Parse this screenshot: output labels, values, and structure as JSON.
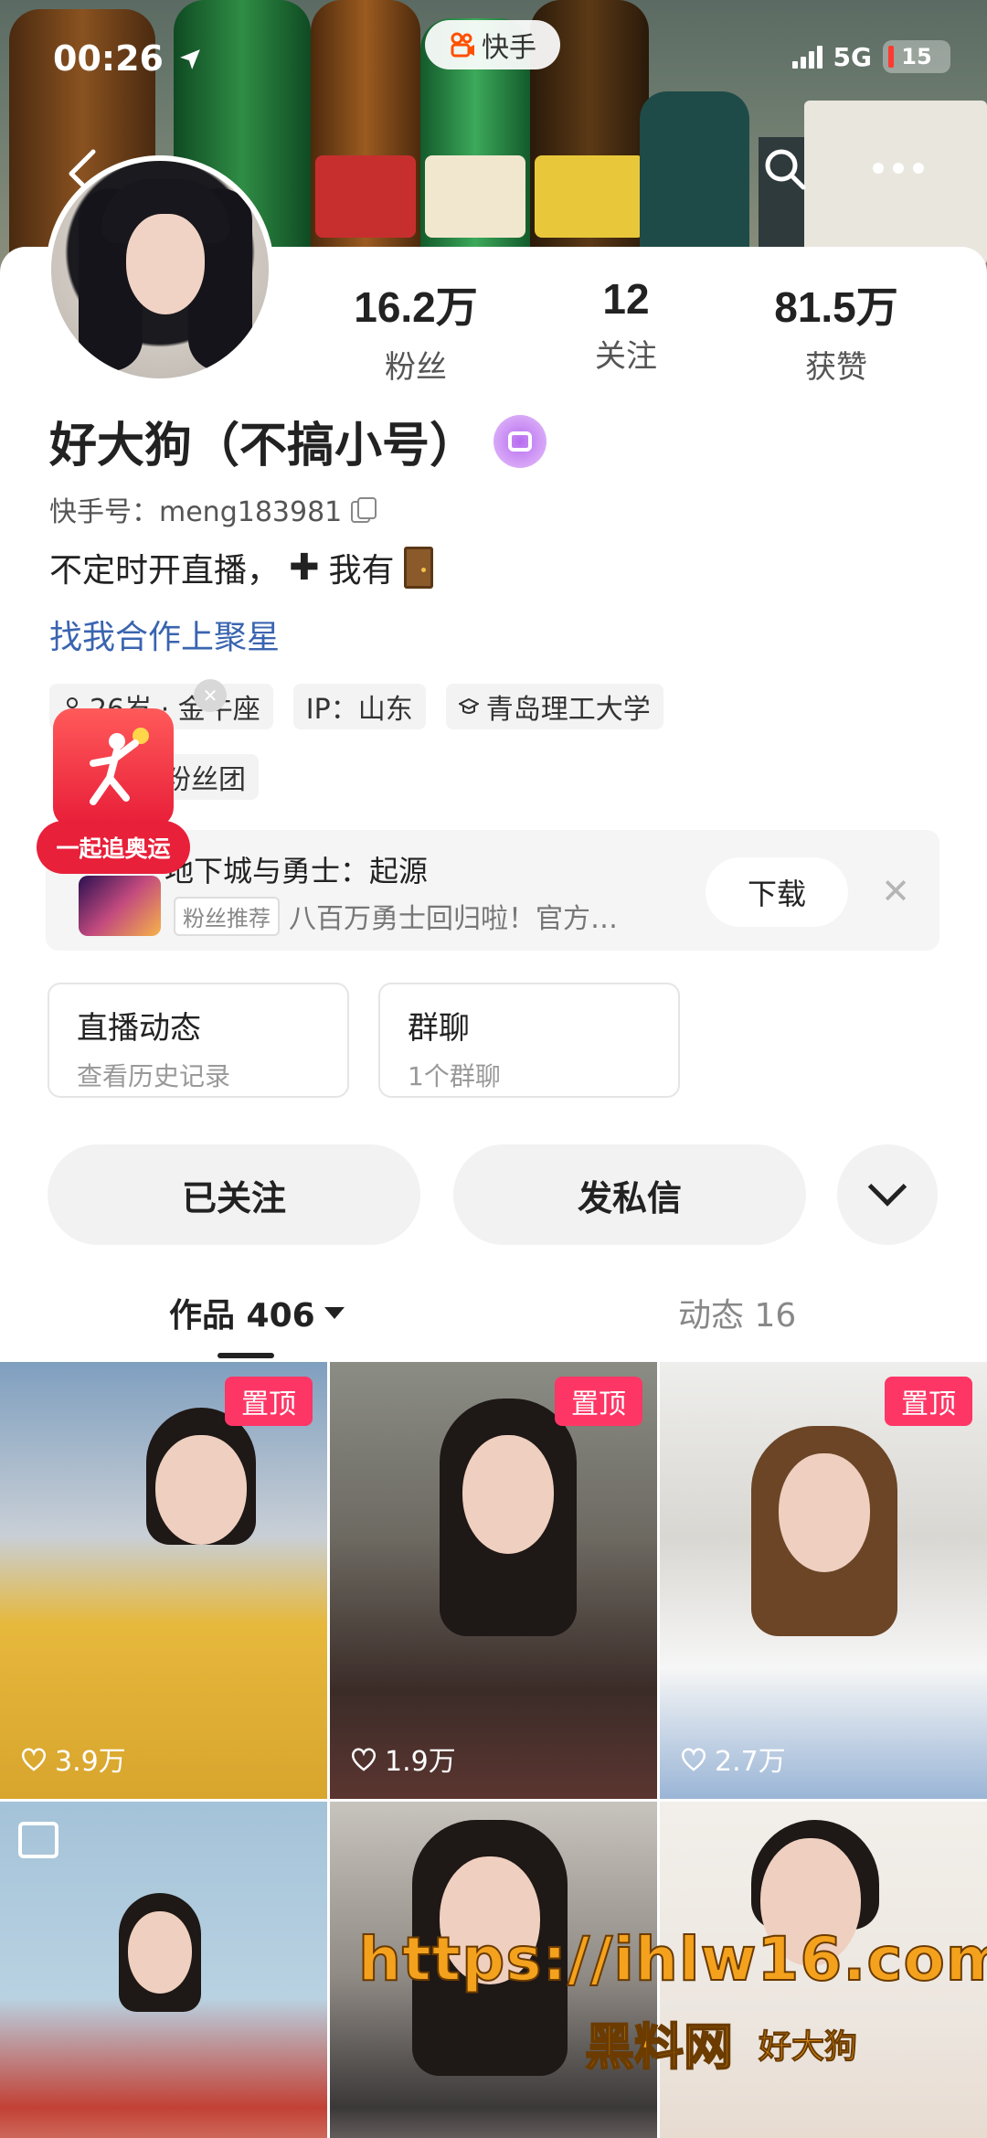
{
  "status_bar": {
    "time": "00:26",
    "network": "5G",
    "battery": "15"
  },
  "app_badge": {
    "label": "快手"
  },
  "profile": {
    "name": "好大狗（不搞小号）",
    "ks_id": "快手号：meng183981",
    "bio_text": "不定时开直播，",
    "bio_suffix": "我有",
    "coop_link": "找我合作上聚星"
  },
  "stats": [
    {
      "value": "16.2万",
      "label": "粉丝"
    },
    {
      "value": "12",
      "label": "关注"
    },
    {
      "value": "81.5万",
      "label": "获赞"
    }
  ],
  "tags": [
    {
      "label": "26岁 · 金牛座",
      "icon": "person-icon"
    },
    {
      "label": "IP：山东",
      "icon": ""
    },
    {
      "label": "青岛理工大学",
      "icon": "graduation-cap-icon"
    }
  ],
  "fans_tag": "粉丝团",
  "olympic": {
    "label": "一起追奥运"
  },
  "game_ad": {
    "title": "地下城与勇士：起源",
    "badge": "粉丝推荐",
    "desc": "八百万勇士回归啦！官方…",
    "download": "下载"
  },
  "cards": [
    {
      "title": "直播动态",
      "sub": "查看历史记录"
    },
    {
      "title": "群聊",
      "sub": "1个群聊"
    }
  ],
  "actions": {
    "follow": "已关注",
    "message": "发私信"
  },
  "tabs": {
    "works": "作品 406",
    "dynamics": "动态 16"
  },
  "grid": [
    {
      "pinned": "置顶",
      "likes": "3.9万"
    },
    {
      "pinned": "置顶",
      "likes": "1.9万"
    },
    {
      "pinned": "置顶",
      "likes": "2.7万"
    },
    {
      "pinned": "",
      "likes": ""
    },
    {
      "pinned": "",
      "likes": ""
    },
    {
      "pinned": "",
      "likes": ""
    }
  ],
  "watermark": {
    "url": "https://ihlw16.com",
    "site": "黑料网",
    "name": "好大狗"
  },
  "colors": {
    "pin": "#fe3666",
    "link": "#3a64b0",
    "verify": "#b76df0"
  }
}
